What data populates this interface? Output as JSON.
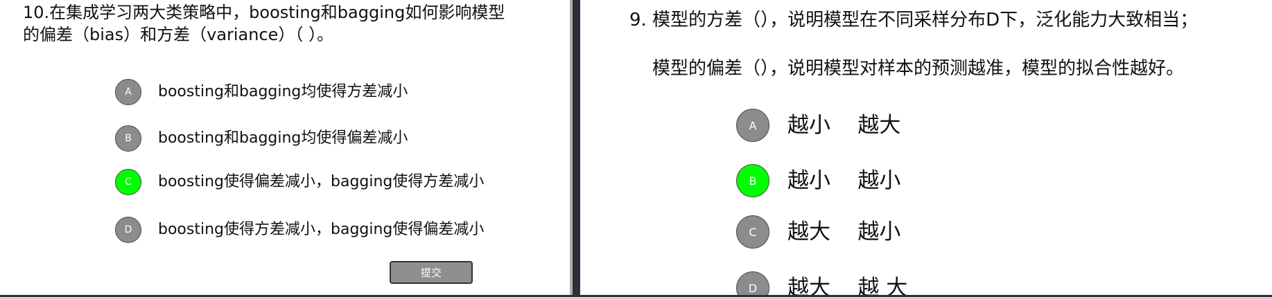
{
  "left_panel": {
    "question": {
      "line1": "10.在集成学习两大类策略中，boosting和bagging如何影响模型",
      "line2": "的偏差（bias）和方差（variance）（    ）。"
    },
    "options": [
      {
        "letter": "A",
        "text": "boosting和bagging均使得方差减小",
        "selected": false
      },
      {
        "letter": "B",
        "text": "boosting和bagging均使得偏差减小",
        "selected": false
      },
      {
        "letter": "C",
        "text": "boosting使得偏差减小，bagging使得方差减小",
        "selected": true
      },
      {
        "letter": "D",
        "text": "boosting使得方差减小，bagging使得偏差减小",
        "selected": false
      }
    ],
    "submit_label": "提交"
  },
  "right_panel": {
    "question": {
      "line1": "9. 模型的方差（），说明模型在不同采样分布D下，泛化能力大致相当；",
      "line2": "模型的偏差（），说明模型对样本的预测越准，模型的拟合性越好。"
    },
    "options": [
      {
        "letter": "A",
        "text": "越小    越大",
        "selected": false
      },
      {
        "letter": "B",
        "text": "越小    越小",
        "selected": true
      },
      {
        "letter": "C",
        "text": "越大    越小",
        "selected": false
      },
      {
        "letter": "D",
        "text": "越大    越 大",
        "selected": false
      }
    ]
  },
  "colors": {
    "selected": "#00ff00",
    "unselected": "#8c8c8c",
    "divider": "#2b2f38",
    "button": "#8f8f8f"
  }
}
